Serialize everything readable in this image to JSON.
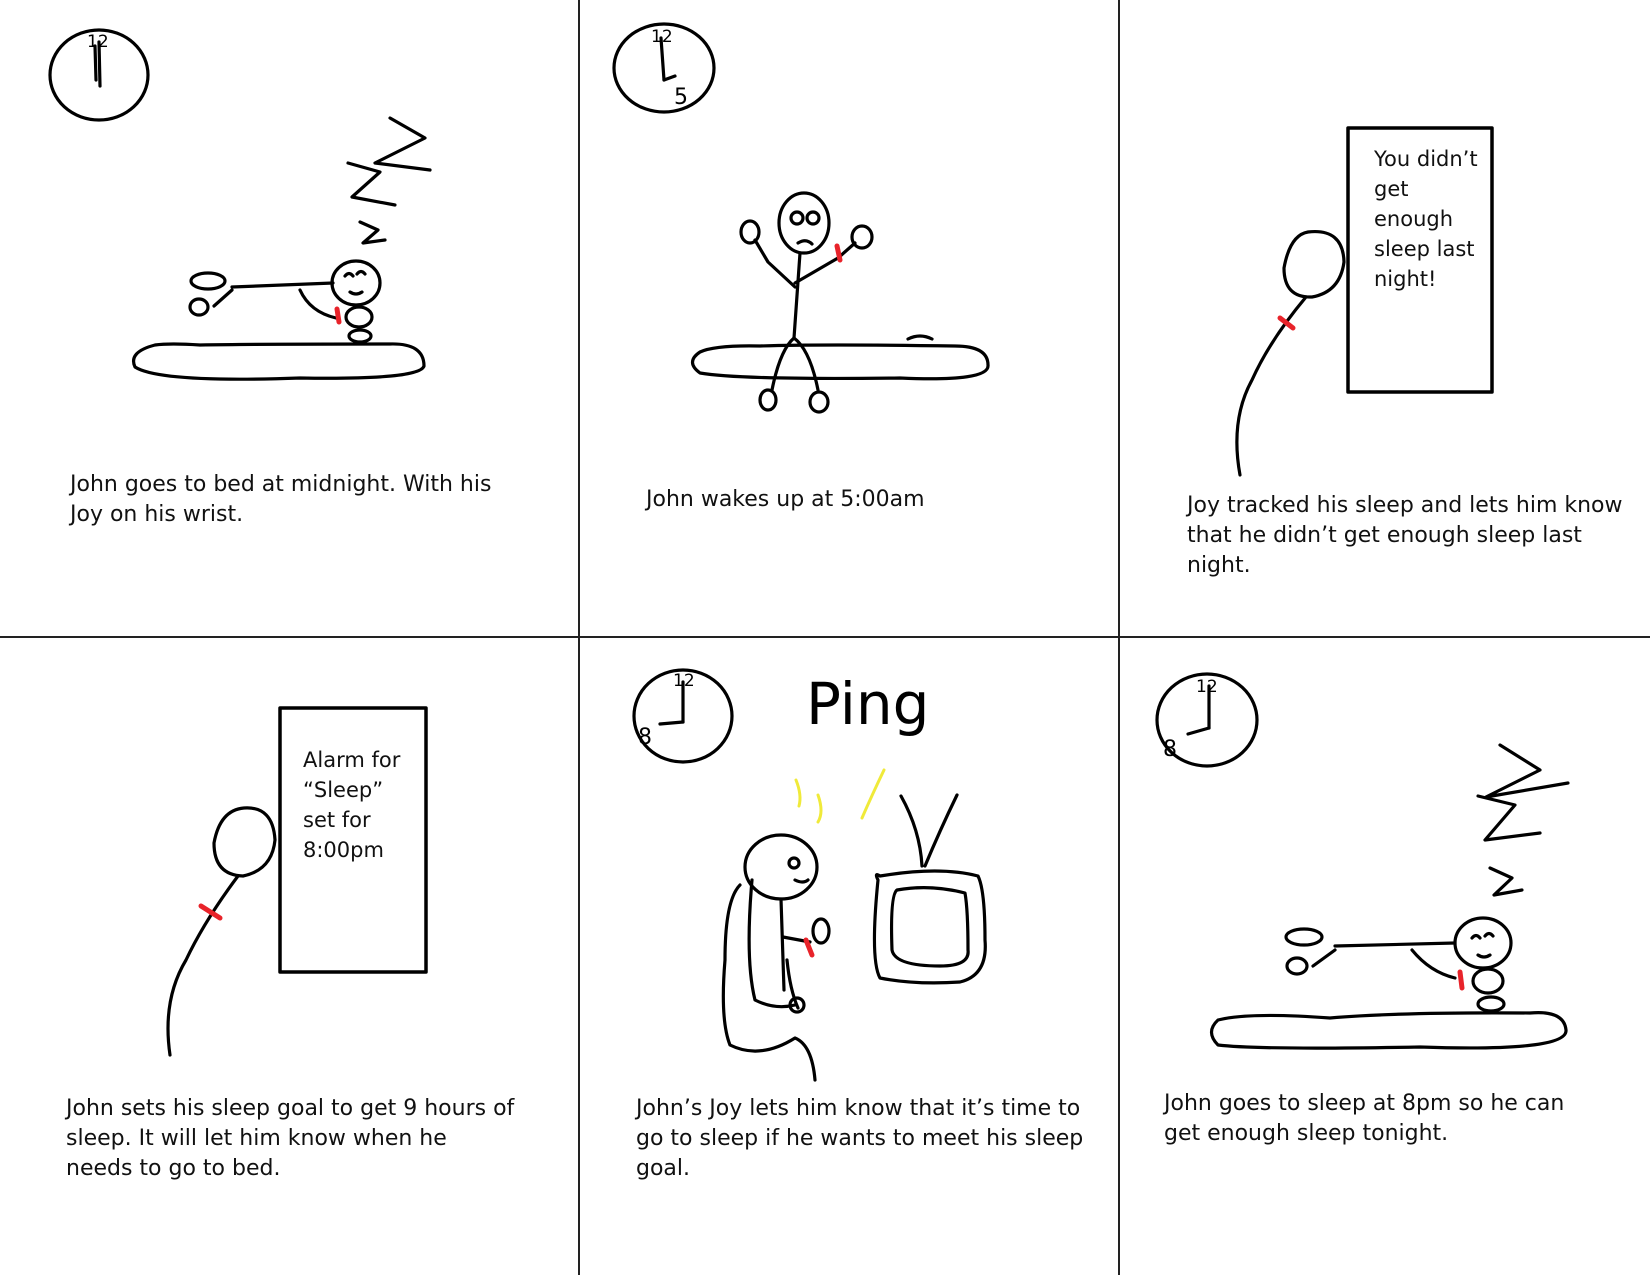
{
  "panels": [
    {
      "caption": "John goes to bed at midnight. With his Joy on his wrist.",
      "clock_label": "12"
    },
    {
      "caption": "John wakes up at 5:00am",
      "clock_label": "12",
      "clock_hour_label": "5"
    },
    {
      "caption": "Joy tracked his sleep and lets him know that he didn’t get enough sleep last night.",
      "screen_text": "You didn’t get enough sleep last night!"
    },
    {
      "caption": "John sets his sleep goal to get 9 hours of sleep. It will let him know when he needs to go to bed.",
      "screen_text": "Alarm for “Sleep” set for 8:00pm"
    },
    {
      "caption": "John’s Joy lets him know that it’s time to go to sleep if he wants to meet his sleep goal.",
      "clock_label": "12",
      "clock_hour_label": "8",
      "sound": "Ping"
    },
    {
      "caption": "John goes to sleep at 8pm so he can get enough sleep tonight.",
      "clock_label": "12",
      "clock_hour_label": "8"
    }
  ],
  "colors": {
    "band": "#e8232a",
    "ping_lines": "#f0ea3a",
    "ink": "#000000"
  }
}
